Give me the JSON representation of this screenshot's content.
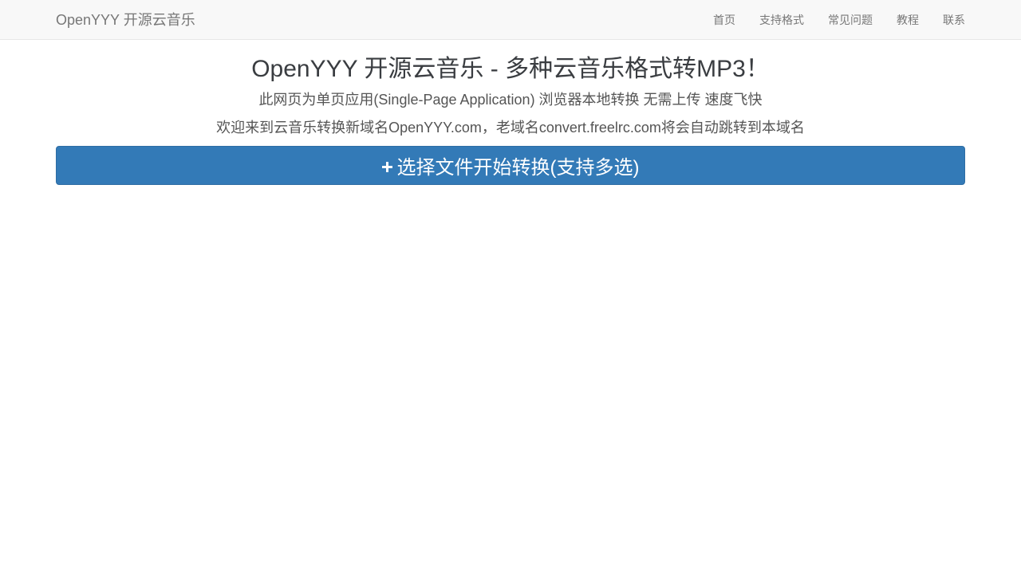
{
  "navbar": {
    "brand": "OpenYYY 开源云音乐",
    "items": [
      {
        "label": "首页"
      },
      {
        "label": "支持格式"
      },
      {
        "label": "常见问题"
      },
      {
        "label": "教程"
      },
      {
        "label": "联系"
      }
    ]
  },
  "hero": {
    "title": "OpenYYY 开源云音乐 - 多种云音乐格式转MP3！",
    "subtitle": "此网页为单页应用(Single-Page Application) 浏览器本地转换 无需上传 速度飞快",
    "notice": "欢迎来到云音乐转换新域名OpenYYY.com，老域名convert.freelrc.com将会自动跳转到本域名"
  },
  "convert_button": {
    "icon": "plus-icon",
    "label": "选择文件开始转换(支持多选)"
  },
  "colors": {
    "primary": "#337ab7",
    "navbar_bg": "#f8f8f8",
    "nav_text": "#777777"
  }
}
